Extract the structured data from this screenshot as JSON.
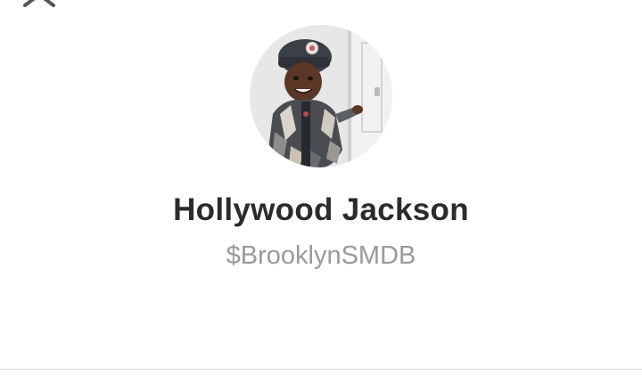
{
  "header": {
    "close_icon": "close-icon"
  },
  "profile": {
    "avatar_icon": "avatar",
    "name": "Hollywood Jackson",
    "cashtag": "$BrooklynSMDB"
  }
}
